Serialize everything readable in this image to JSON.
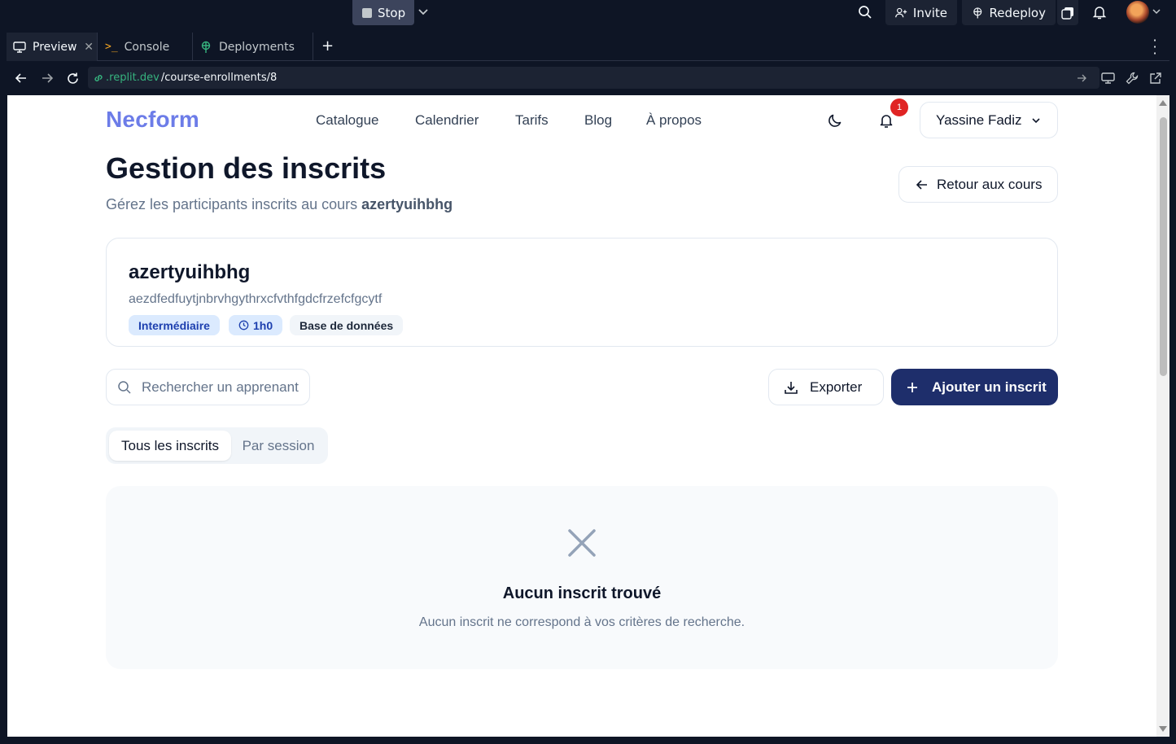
{
  "replit": {
    "stop_label": "Stop",
    "invite_label": "Invite",
    "redeploy_label": "Redeploy",
    "tabs": [
      {
        "label": "Preview"
      },
      {
        "label": "Console"
      },
      {
        "label": "Deployments"
      }
    ],
    "url": {
      "host": ".replit.dev",
      "path": "/course-enrollments/8"
    }
  },
  "page": {
    "logo": "Necform",
    "nav": [
      "Catalogue",
      "Calendrier",
      "Tarifs",
      "Blog",
      "À propos"
    ],
    "notification_count": "1",
    "user_name": "Yassine Fadiz",
    "title": "Gestion des inscrits",
    "subtitle_prefix": "Gérez les participants inscrits au cours",
    "course_name": "azertyuihbhg",
    "back_label": "Retour aux cours",
    "course": {
      "title": "azertyuihbhg",
      "description": "aezdfedfuytjnbrvhgythrxcfvthfgdcfrzefcfgcytf",
      "level": "Intermédiaire",
      "duration": "1h0",
      "category": "Base de données"
    },
    "search_placeholder": "Rechercher un apprenant",
    "export_label": "Exporter",
    "add_label": "Ajouter un inscrit",
    "segments": [
      "Tous les inscrits",
      "Par session"
    ],
    "empty_title": "Aucun inscrit trouvé",
    "empty_desc": "Aucun inscrit ne correspond à vos critères de recherche."
  },
  "colors": {
    "brand": "#6c7ce8",
    "primary_button": "#1e2e6b",
    "badge_red": "#e02424",
    "ide_bg": "#0e1525"
  }
}
